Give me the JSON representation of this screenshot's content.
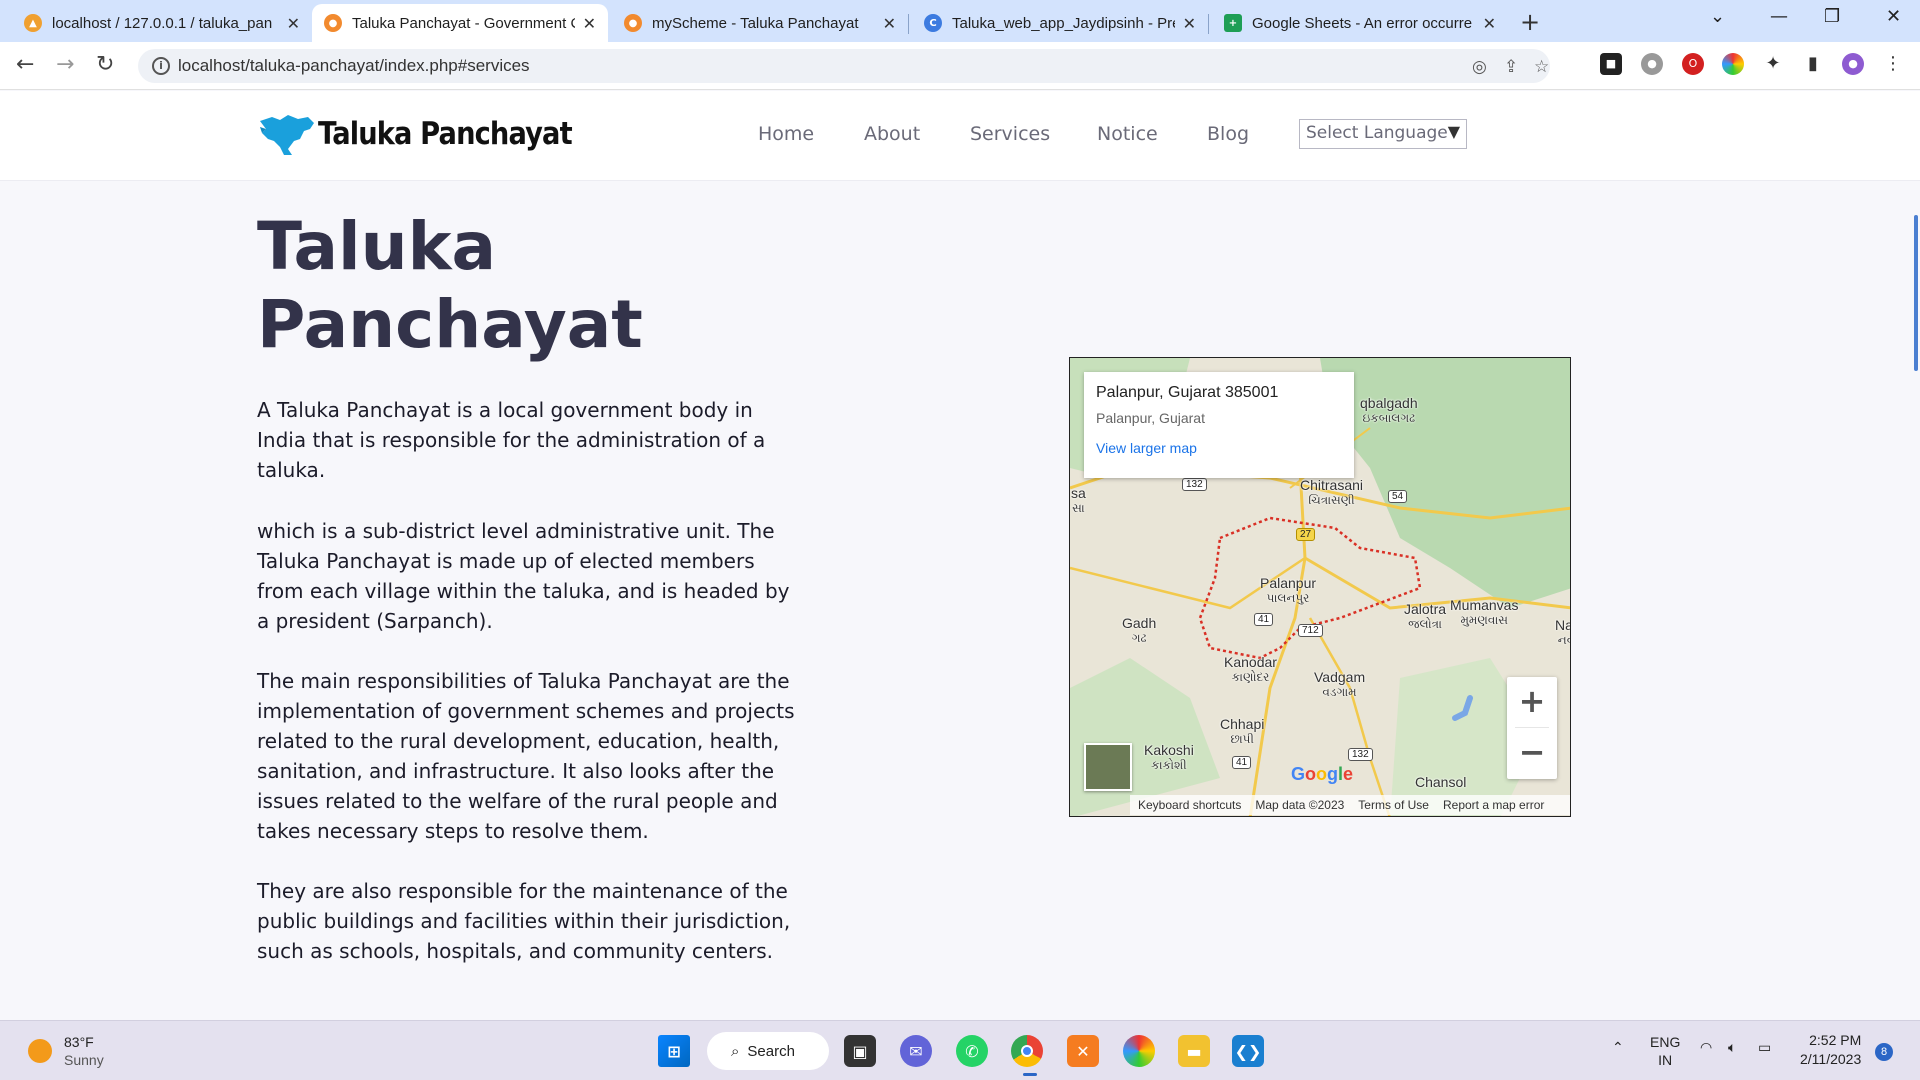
{
  "browser": {
    "tabs": [
      {
        "title": "localhost / 127.0.0.1 / taluka_pan",
        "icon": "phpmyadmin-icon"
      },
      {
        "title": "Taluka Panchayat - Government C",
        "icon": "site-favicon",
        "active": true
      },
      {
        "title": "myScheme - Taluka Panchayat",
        "icon": "site-favicon"
      },
      {
        "title": "Taluka_web_app_Jaydipsinh - Pre",
        "icon": "canva-icon"
      },
      {
        "title": "Google Sheets - An error occurre",
        "icon": "sheets-icon"
      }
    ],
    "url": "localhost/taluka-panchayat/index.php#services"
  },
  "site": {
    "brand": "Taluka Panchayat",
    "nav": [
      "Home",
      "About",
      "Services",
      "Notice",
      "Blog"
    ],
    "language_select": "Select Language"
  },
  "main": {
    "title": "Taluka Panchayat",
    "paragraphs": [
      "A Taluka Panchayat is a local government body in India that is responsible for the administration of a taluka.",
      "which is a sub-district level administrative unit. The Taluka Panchayat is made up of elected members from each village within the taluka, and is headed by a president (Sarpanch).",
      "The main responsibilities of Taluka Panchayat are the implementation of government schemes and projects related to the rural development, education, health, sanitation, and infrastructure. It also looks after the issues related to the welfare of the rural people and takes necessary steps to resolve them.",
      "They are also responsible for the maintenance of the public buildings and facilities within their jurisdiction, such as schools, hospitals, and community centers."
    ]
  },
  "map": {
    "card_address": "Palanpur, Gujarat 385001",
    "card_sub": "Palanpur, Gujarat",
    "card_link": "View larger map",
    "places": {
      "palanpur": "Palanpur",
      "palanpur_gu": "પાલનપુર",
      "chitrasani": "Chitrasani",
      "chitrasani_gu": "ચિત્રાસણી",
      "iqbalgadh": "qbalgadh",
      "iqbalgadh_gu": "ઇકબાલગઢ",
      "gadh": "Gadh",
      "gadh_gu": "ગઢ",
      "jalotra": "Jalotra",
      "jalotra_gu": "જલોત્રા",
      "mumanvas": "Mumanvas",
      "mumanvas_gu": "મુમણવાસ",
      "kanodar": "Kanodar",
      "kanodar_gu": "કાણોદર",
      "vadgam": "Vadgam",
      "vadgam_gu": "વડગામ",
      "chhapi": "Chhapi",
      "chhapi_gu": "છાપી",
      "kakoshi": "Kakoshi",
      "kakoshi_gu": "કાકોશી",
      "chansol": "Chansol",
      "nava": "Nav",
      "nava_gu": "નવા",
      "sa": "sa",
      "sa_gu": "સા"
    },
    "shields": [
      "132",
      "54",
      "27",
      "41",
      "712",
      "41",
      "132"
    ],
    "google": "Google",
    "footer": [
      "Keyboard shortcuts",
      "Map data ©2023",
      "Terms of Use",
      "Report a map error"
    ],
    "zoom_in": "+",
    "zoom_out": "−"
  },
  "taskbar": {
    "temp": "83°F",
    "condition": "Sunny",
    "search": "Search",
    "lang": "ENG",
    "region": "IN",
    "time": "2:52 PM",
    "date": "2/11/2023",
    "notifications": "8"
  }
}
